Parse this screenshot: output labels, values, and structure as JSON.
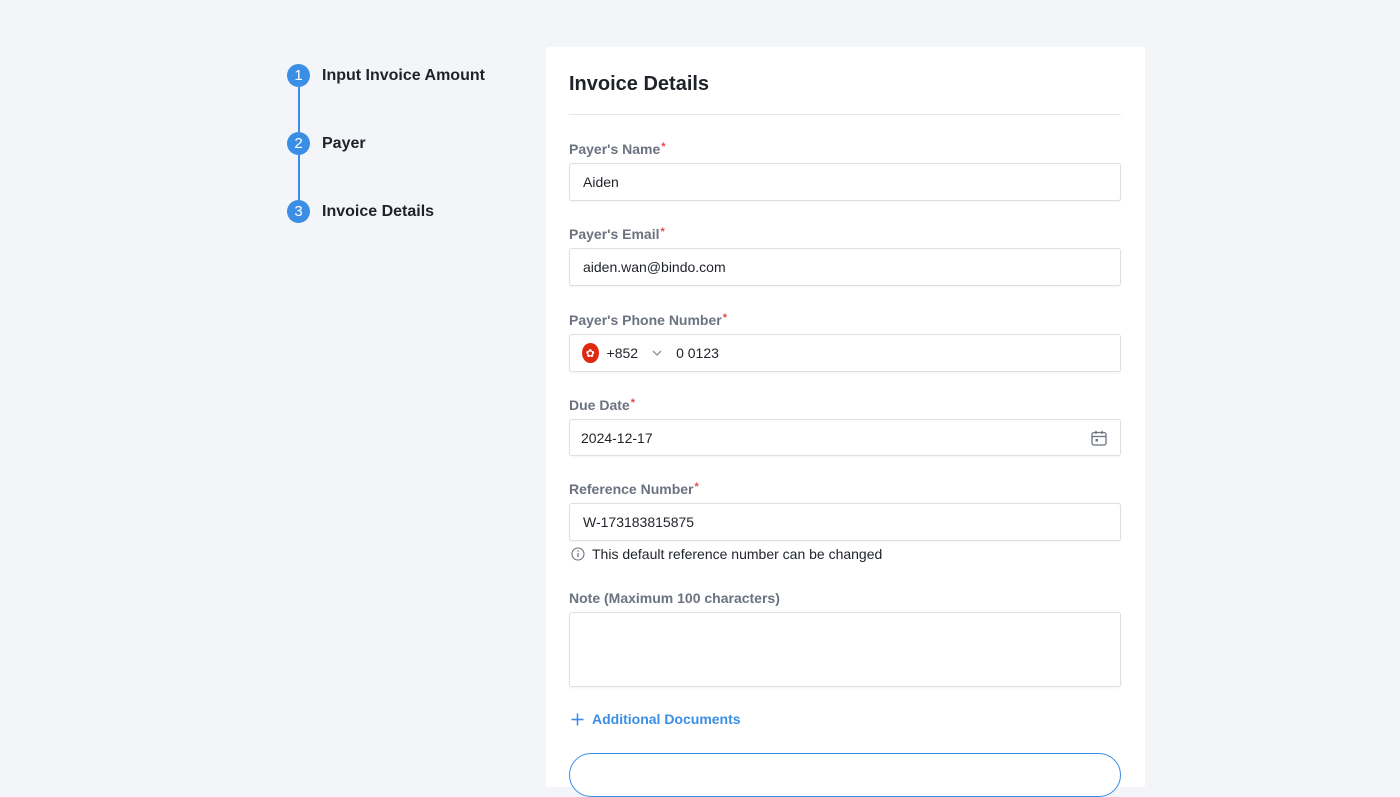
{
  "stepper": {
    "steps": [
      {
        "number": "1",
        "label": "Input Invoice Amount"
      },
      {
        "number": "2",
        "label": "Payer"
      },
      {
        "number": "3",
        "label": "Invoice Details"
      }
    ]
  },
  "form": {
    "title": "Invoice Details",
    "required_mark": "*",
    "payer_name": {
      "label": "Payer's Name",
      "value": "Aiden"
    },
    "payer_email": {
      "label": "Payer's Email",
      "value": "aiden.wan@bindo.com"
    },
    "payer_phone": {
      "label": "Payer's Phone Number",
      "flag_glyph": "✿",
      "dial_code": "+852",
      "value": "0 0123"
    },
    "due_date": {
      "label": "Due Date",
      "value": "2024-12-17"
    },
    "reference_number": {
      "label": "Reference Number",
      "value": "W-173183815875",
      "hint": "This default reference number can be changed"
    },
    "note": {
      "label": "Note (Maximum 100 characters)",
      "value": ""
    },
    "additional_documents_label": "Additional Documents"
  },
  "colors": {
    "accent": "#3a8ee6",
    "required": "#e5484d",
    "background": "#f3f5f8",
    "flag": "#de2910"
  },
  "icons": {
    "calendar": "calendar-icon",
    "info": "info-icon",
    "plus": "plus-icon",
    "chevron": "chevron-down-icon",
    "flag": "hong-kong-flag-icon"
  }
}
